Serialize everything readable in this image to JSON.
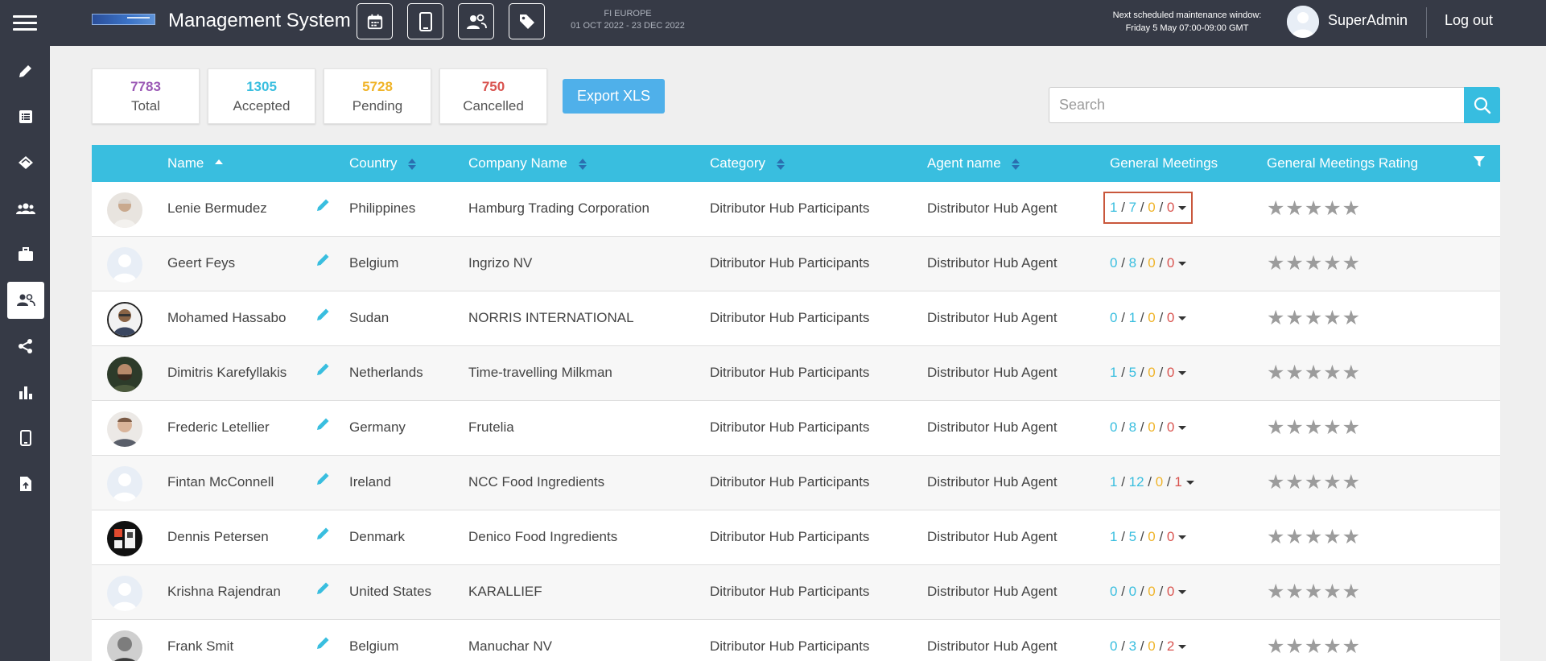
{
  "header": {
    "app_title": "Management System",
    "event_name": "FI EUROPE",
    "event_dates": "01 OCT 2022 - 23 DEC 2022",
    "maintenance_line1": "Next scheduled maintenance window:",
    "maintenance_line2": "Friday 5 May 07:00-09:00 GMT",
    "username": "SuperAdmin",
    "logout_label": "Log out",
    "toolbar_icons": [
      "calendar-icon",
      "mobile-icon",
      "users-icon",
      "tag-icon"
    ]
  },
  "sidebar": {
    "items": [
      "pencil-icon",
      "list-icon",
      "handshake-icon",
      "group-icon",
      "briefcase-icon",
      "people-icon",
      "share-icon",
      "bar-chart-icon",
      "mobile-icon",
      "file-upload-icon"
    ],
    "active_index": 5
  },
  "stats": [
    {
      "value": "7783",
      "label": "Total",
      "color": "#9b59b6"
    },
    {
      "value": "1305",
      "label": "Accepted",
      "color": "#39bedf"
    },
    {
      "value": "5728",
      "label": "Pending",
      "color": "#f0b429"
    },
    {
      "value": "750",
      "label": "Cancelled",
      "color": "#d9534f"
    }
  ],
  "export_label": "Export XLS",
  "search": {
    "placeholder": "Search",
    "value": ""
  },
  "colors": {
    "accent": "#39bedf",
    "topbar": "#363a46",
    "export": "#4fb0ea",
    "highlight": "#c9573c"
  },
  "table": {
    "headers": {
      "name": "Name",
      "country": "Country",
      "company": "Company Name",
      "category": "Category",
      "agent": "Agent name",
      "meetings": "General Meetings",
      "rating": "General Meetings Rating"
    },
    "rows": [
      {
        "name": "Lenie Bermudez",
        "country": "Philippines",
        "company": "Hamburg Trading Corporation",
        "category": "Ditributor Hub Participants",
        "agent": "Distributor Hub Agent",
        "m1": "1",
        "m2": "7",
        "m3": "0",
        "m4": "0",
        "stars": "★★★★★",
        "avatar": "photo-woman"
      },
      {
        "name": "Geert Feys",
        "country": "Belgium",
        "company": "Ingrizo NV",
        "category": "Ditributor Hub Participants",
        "agent": "Distributor Hub Agent",
        "m1": "0",
        "m2": "8",
        "m3": "0",
        "m4": "0",
        "stars": "★★★★★",
        "avatar": "placeholder"
      },
      {
        "name": "Mohamed Hassabo",
        "country": "Sudan",
        "company": "NORRIS INTERNATIONAL",
        "category": "Ditributor Hub Participants",
        "agent": "Distributor Hub Agent",
        "m1": "0",
        "m2": "1",
        "m3": "0",
        "m4": "0",
        "stars": "★★★★★",
        "avatar": "photo-man-glasses"
      },
      {
        "name": "Dimitris Karefyllakis",
        "country": "Netherlands",
        "company": "Time-travelling Milkman",
        "category": "Ditributor Hub Participants",
        "agent": "Distributor Hub Agent",
        "m1": "1",
        "m2": "5",
        "m3": "0",
        "m4": "0",
        "stars": "★★★★★",
        "avatar": "photo-man-beard"
      },
      {
        "name": "Frederic Letellier",
        "country": "Germany",
        "company": "Frutelia",
        "category": "Ditributor Hub Participants",
        "agent": "Distributor Hub Agent",
        "m1": "0",
        "m2": "8",
        "m3": "0",
        "m4": "0",
        "stars": "★★★★★",
        "avatar": "photo-man"
      },
      {
        "name": "Fintan McConnell",
        "country": "Ireland",
        "company": "NCC Food Ingredients",
        "category": "Ditributor Hub Participants",
        "agent": "Distributor Hub Agent",
        "m1": "1",
        "m2": "12",
        "m3": "0",
        "m4": "1",
        "stars": "★★★★★",
        "avatar": "placeholder"
      },
      {
        "name": "Dennis Petersen",
        "country": "Denmark",
        "company": "Denico Food Ingredients",
        "category": "Ditributor Hub Participants",
        "agent": "Distributor Hub Agent",
        "m1": "1",
        "m2": "5",
        "m3": "0",
        "m4": "0",
        "stars": "★★★★★",
        "avatar": "logo-dark"
      },
      {
        "name": "Krishna Rajendran",
        "country": "United States",
        "company": "KARALLIEF",
        "category": "Ditributor Hub Participants",
        "agent": "Distributor Hub Agent",
        "m1": "0",
        "m2": "0",
        "m3": "0",
        "m4": "0",
        "stars": "★★★★★",
        "avatar": "placeholder"
      },
      {
        "name": "Frank Smit",
        "country": "Belgium",
        "company": "Manuchar NV",
        "category": "Ditributor Hub Participants",
        "agent": "Distributor Hub Agent",
        "m1": "0",
        "m2": "3",
        "m3": "0",
        "m4": "2",
        "stars": "★★★★★",
        "avatar": "photo-man-bw"
      }
    ]
  }
}
